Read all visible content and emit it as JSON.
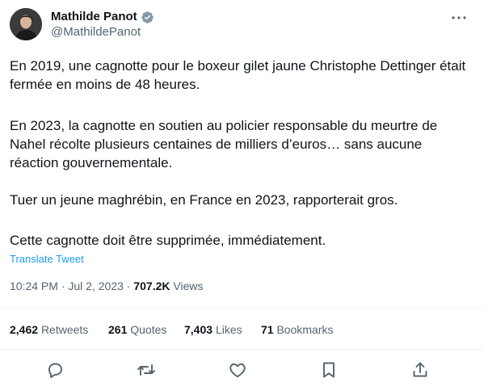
{
  "author": {
    "display_name": "Mathilde Panot",
    "handle": "@MathildePanot",
    "verified": true
  },
  "tweet": {
    "paragraphs": [
      "En 2019, une cagnotte pour le boxeur gilet jaune Christophe Dettinger était fermée en moins de 48 heures.",
      "En 2023, la cagnotte en soutien au policier responsable du meurtre de Nahel récolte plusieurs centaines de milliers d’euros… sans aucune réaction gouvernementale.",
      "Tuer un jeune maghrébin, en France en 2023, rapporterait gros.",
      "Cette cagnotte doit être supprimée, immédiatement."
    ],
    "translate_label": "Translate Tweet"
  },
  "meta": {
    "time": "10:24 PM",
    "separator": "·",
    "date": "Jul 2, 2023",
    "views_count": "707.2K",
    "views_label": "Views"
  },
  "stats": {
    "retweets_count": "2,462",
    "retweets_label": "Retweets",
    "quotes_count": "261",
    "quotes_label": "Quotes",
    "likes_count": "7,403",
    "likes_label": "Likes",
    "bookmarks_count": "71",
    "bookmarks_label": "Bookmarks"
  },
  "actions": [
    "reply-icon",
    "retweet-icon",
    "like-icon",
    "bookmark-icon",
    "share-icon"
  ],
  "colors": {
    "text": "#0f1419",
    "secondary": "#536471",
    "link": "#1d9bf0",
    "divider": "#eff3f4"
  }
}
